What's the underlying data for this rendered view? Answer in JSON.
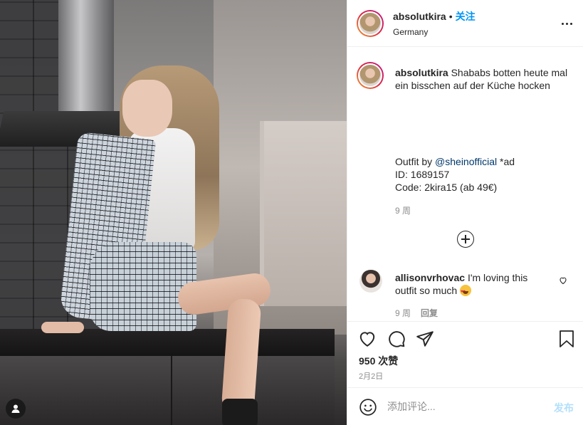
{
  "header": {
    "username": "absolutkira",
    "separator": "•",
    "follow_label": "关注",
    "location": "Germany",
    "more_icon": "more-options-icon"
  },
  "caption": {
    "username": "absolutkira",
    "text": "Shababs botten heute mal ein bisschen auf der Küche hocken",
    "outfit_prefix": "Outfit by ",
    "mention": "@sheinofficial",
    "outfit_suffix": " *ad",
    "id_line": "ID: 1689157",
    "code_line": "Code: 2kira15 (ab 49€)",
    "time": "9 周"
  },
  "comment": {
    "username": "allisonvrhovac",
    "text_before": "I'm loving this outfit so much ",
    "emoji": "heart-eyes-emoji",
    "time": "9 周",
    "reply_label": "回复"
  },
  "actions": {
    "likes": "950 次赞",
    "date": "2月2日"
  },
  "add_comment": {
    "placeholder": "添加评论...",
    "post_label": "发布"
  },
  "colors": {
    "accent": "#0095f6",
    "mention": "#00376b",
    "muted": "#8e8e8e",
    "post_disabled": "#b2dffc"
  }
}
